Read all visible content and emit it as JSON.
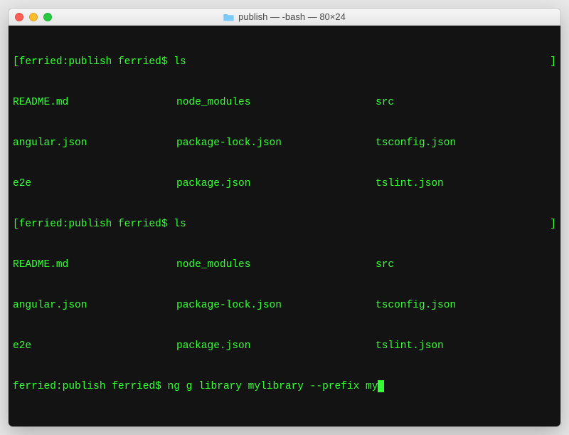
{
  "window": {
    "title": "publish — -bash — 80×24"
  },
  "session": {
    "prompt": "ferried:publish ferried$",
    "ls_cmd": "ls",
    "bracket_open": "[",
    "bracket_close": "]",
    "files_row1": {
      "c1": "README.md",
      "c2": "node_modules",
      "c3": "src"
    },
    "files_row2": {
      "c1": "angular.json",
      "c2": "package-lock.json",
      "c3": "tsconfig.json"
    },
    "files_row3": {
      "c1": "e2e",
      "c2": "package.json",
      "c3": "tslint.json"
    },
    "current_cmd": "ng g library mylibrary --prefix my"
  }
}
